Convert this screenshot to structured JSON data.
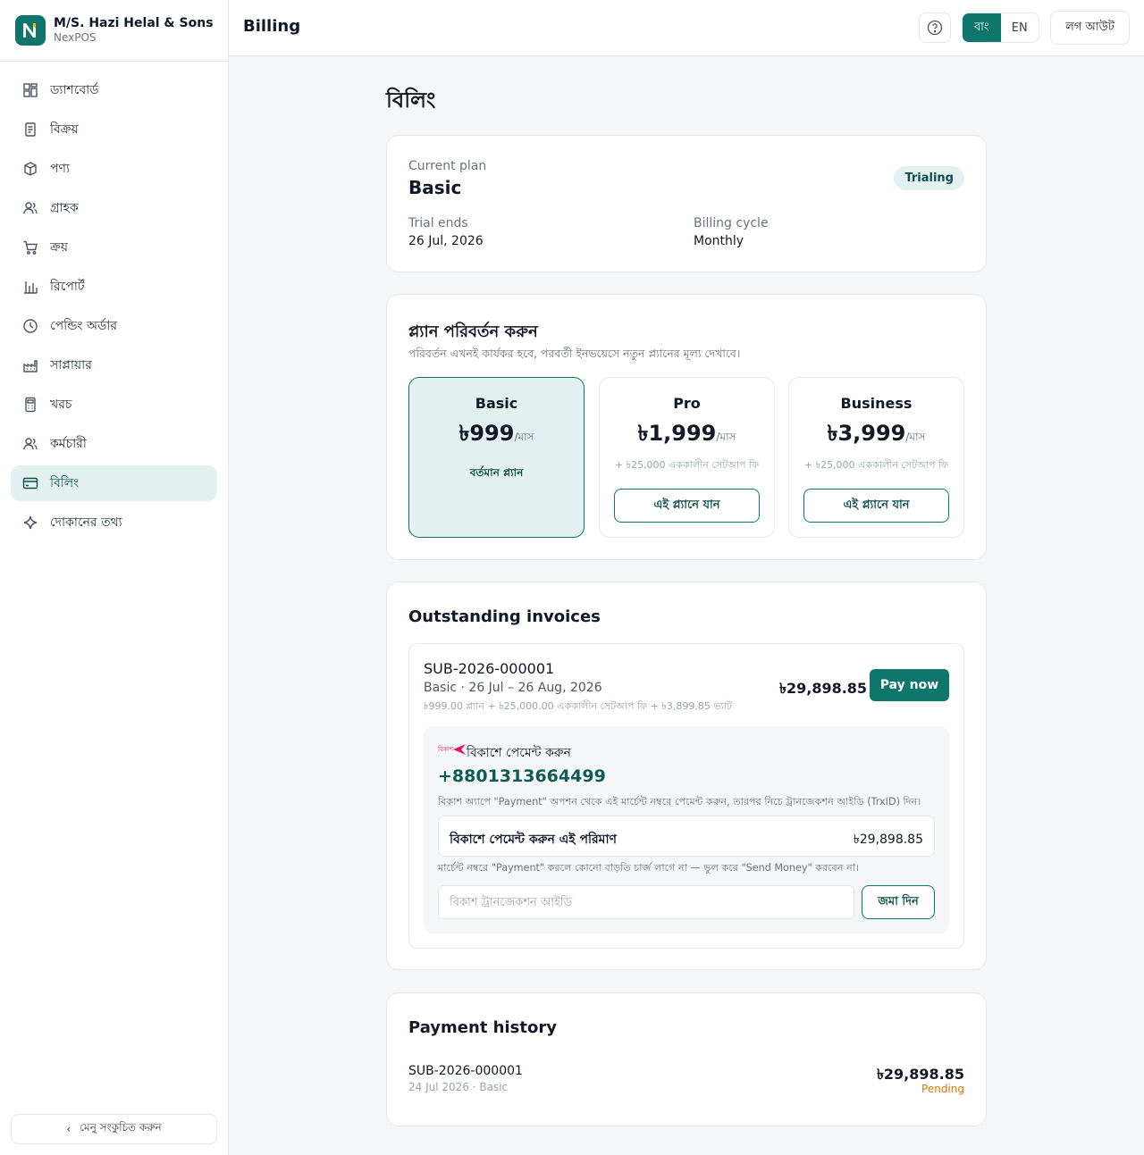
{
  "brand": {
    "name": "M/S. Hazi Helal & Sons",
    "sub": "NexPOS"
  },
  "sidebar": {
    "items": [
      {
        "id": "dashboard",
        "label": "ড্যাশবোর্ড"
      },
      {
        "id": "sales",
        "label": "বিক্রয়"
      },
      {
        "id": "products",
        "label": "পণ্য"
      },
      {
        "id": "customers",
        "label": "গ্রাহক"
      },
      {
        "id": "purchases",
        "label": "ক্রয়"
      },
      {
        "id": "reports",
        "label": "রিপোর্ট"
      },
      {
        "id": "pending-orders",
        "label": "পেন্ডিং অর্ডার"
      },
      {
        "id": "suppliers",
        "label": "সাপ্লায়ার"
      },
      {
        "id": "expenses",
        "label": "খরচ"
      },
      {
        "id": "employees",
        "label": "কর্মচারী"
      },
      {
        "id": "billing",
        "label": "বিলিং"
      },
      {
        "id": "shop-info",
        "label": "দোকানের তথ্য"
      }
    ],
    "active": "billing",
    "collapse_label": "মেনু সংকুচিত করুন"
  },
  "topbar": {
    "title": "Billing",
    "lang": {
      "bn": "বাং",
      "en": "EN",
      "active": "bn"
    },
    "logout_label": "লগ আউট"
  },
  "main": {
    "heading": "বিলিং",
    "current_plan": {
      "label": "Current plan",
      "name": "Basic",
      "status": "Trialing",
      "trial_ends_label": "Trial ends",
      "trial_ends": "26 Jul, 2026",
      "cycle_label": "Billing cycle",
      "cycle": "Monthly"
    },
    "change_plan": {
      "title": "প্ল্যান পরিবর্তন করুন",
      "subtitle": "পরিবর্তন এখনই কার্যকর হবে, পরবর্তী ইনভয়েসে নতুন প্ল্যানের মূল্য দেখাবে।",
      "per_month": "/মাস",
      "plans": [
        {
          "name": "Basic",
          "price": "৳999",
          "current_label": "বর্তমান প্ল্যান"
        },
        {
          "name": "Pro",
          "price": "৳1,999",
          "setup": "+ ৳25,000 এককালীন সেটআপ ফি",
          "button": "এই প্ল্যানে যান"
        },
        {
          "name": "Business",
          "price": "৳3,999",
          "setup": "+ ৳25,000 এককালীন সেটআপ ফি",
          "button": "এই প্ল্যানে যান"
        }
      ]
    },
    "outstanding": {
      "title": "Outstanding invoices",
      "invoice": {
        "id": "SUB-2026-000001",
        "period": "Basic · 26 Jul – 26 Aug, 2026",
        "breakdown": "৳999.00 প্ল্যান + ৳25,000.00 এককালীন সেটআপ ফি + ৳3,899.85 ভ্যাট",
        "amount": "৳29,898.85",
        "pay_label": "Pay now"
      },
      "bkash": {
        "logo_text": "বিকাশ",
        "title": "বিকাশে পেমেন্ট করুন",
        "number": "+8801313664499",
        "instruction": "বিকাশ অ্যাপে \"Payment\" অপশন থেকে এই মার্চেন্ট নম্বরে পেমেন্ট করুন, তারপর নিচে ট্রানজেকশন আইডি (TrxID) দিন।",
        "amount_label": "বিকাশে পেমেন্ট করুন এই পরিমাণ",
        "amount": "৳29,898.85",
        "note": "মার্চেন্ট নম্বরে \"Payment\" করলে কোনো বাড়তি চার্জ লাগে না — ভুল করে \"Send Money\" করবেন না।",
        "trx_placeholder": "বিকাশ ট্রানজেকশন আইডি",
        "submit_label": "জমা দিন"
      }
    },
    "history": {
      "title": "Payment history",
      "rows": [
        {
          "id": "SUB-2026-000001",
          "meta": "24 Jul 2026 · Basic",
          "amount": "৳29,898.85",
          "status": "Pending"
        }
      ]
    }
  },
  "colors": {
    "accent": "#0f766e",
    "accent_light": "#e3f2f0",
    "pending": "#d97706",
    "bkash": "#e2136e"
  }
}
